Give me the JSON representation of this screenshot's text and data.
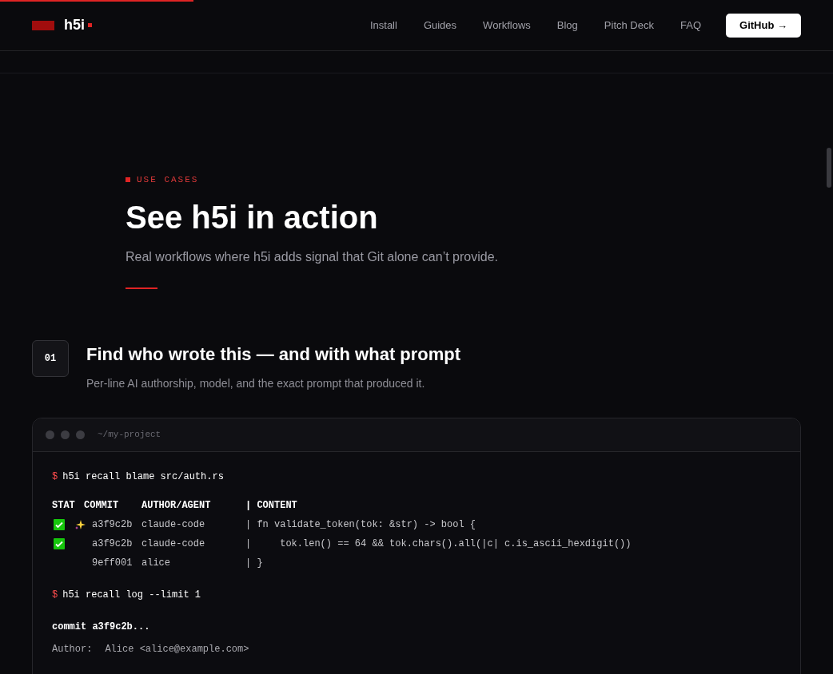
{
  "reading_progress": {
    "level": 0.232
  },
  "nav": {
    "brand": "h5i",
    "links": [
      "Install",
      "Guides",
      "Workflows",
      "Blog",
      "Pitch Deck",
      "FAQ"
    ],
    "cta": "GitHub →"
  },
  "hero": {
    "eyebrow": "USE CASES",
    "title": "See h5i in action",
    "subtitle": "Real workflows where h5i adds signal that Git alone can’t provide."
  },
  "use_case": {
    "number": "01",
    "title": "Find who wrote this — and with what prompt",
    "description": "Per-line AI authorship, model, and the exact prompt that produced it."
  },
  "terminal": {
    "path": "~/my-project",
    "blocks": [
      {
        "kind": "command",
        "prompt": "$",
        "text": "h5i recall blame src/auth.rs"
      },
      {
        "kind": "blame",
        "columns": [
          "STAT",
          "COMMIT",
          "AUTHOR/AGENT",
          "| CONTENT"
        ],
        "rows": [
          {
            "checked": true,
            "ai": true,
            "commit": "a3f9c2b",
            "author": "claude-code",
            "content": "| fn validate_token(tok: &str) -> bool {"
          },
          {
            "checked": true,
            "ai": false,
            "commit": "a3f9c2b",
            "author": "claude-code",
            "content": "|     tok.len() == 64 && tok.chars().all(|c| c.is_ascii_hexdigit())"
          },
          {
            "checked": false,
            "ai": false,
            "commit": "9eff001",
            "author": "alice",
            "content": "| }"
          }
        ]
      },
      {
        "kind": "command",
        "prompt": "$",
        "text": "h5i recall log --limit 1"
      },
      {
        "kind": "heading",
        "text": "commit a3f9c2b..."
      },
      {
        "kind": "field",
        "label": "Author:",
        "text": "Alice <alice@example.com>"
      }
    ]
  }
}
